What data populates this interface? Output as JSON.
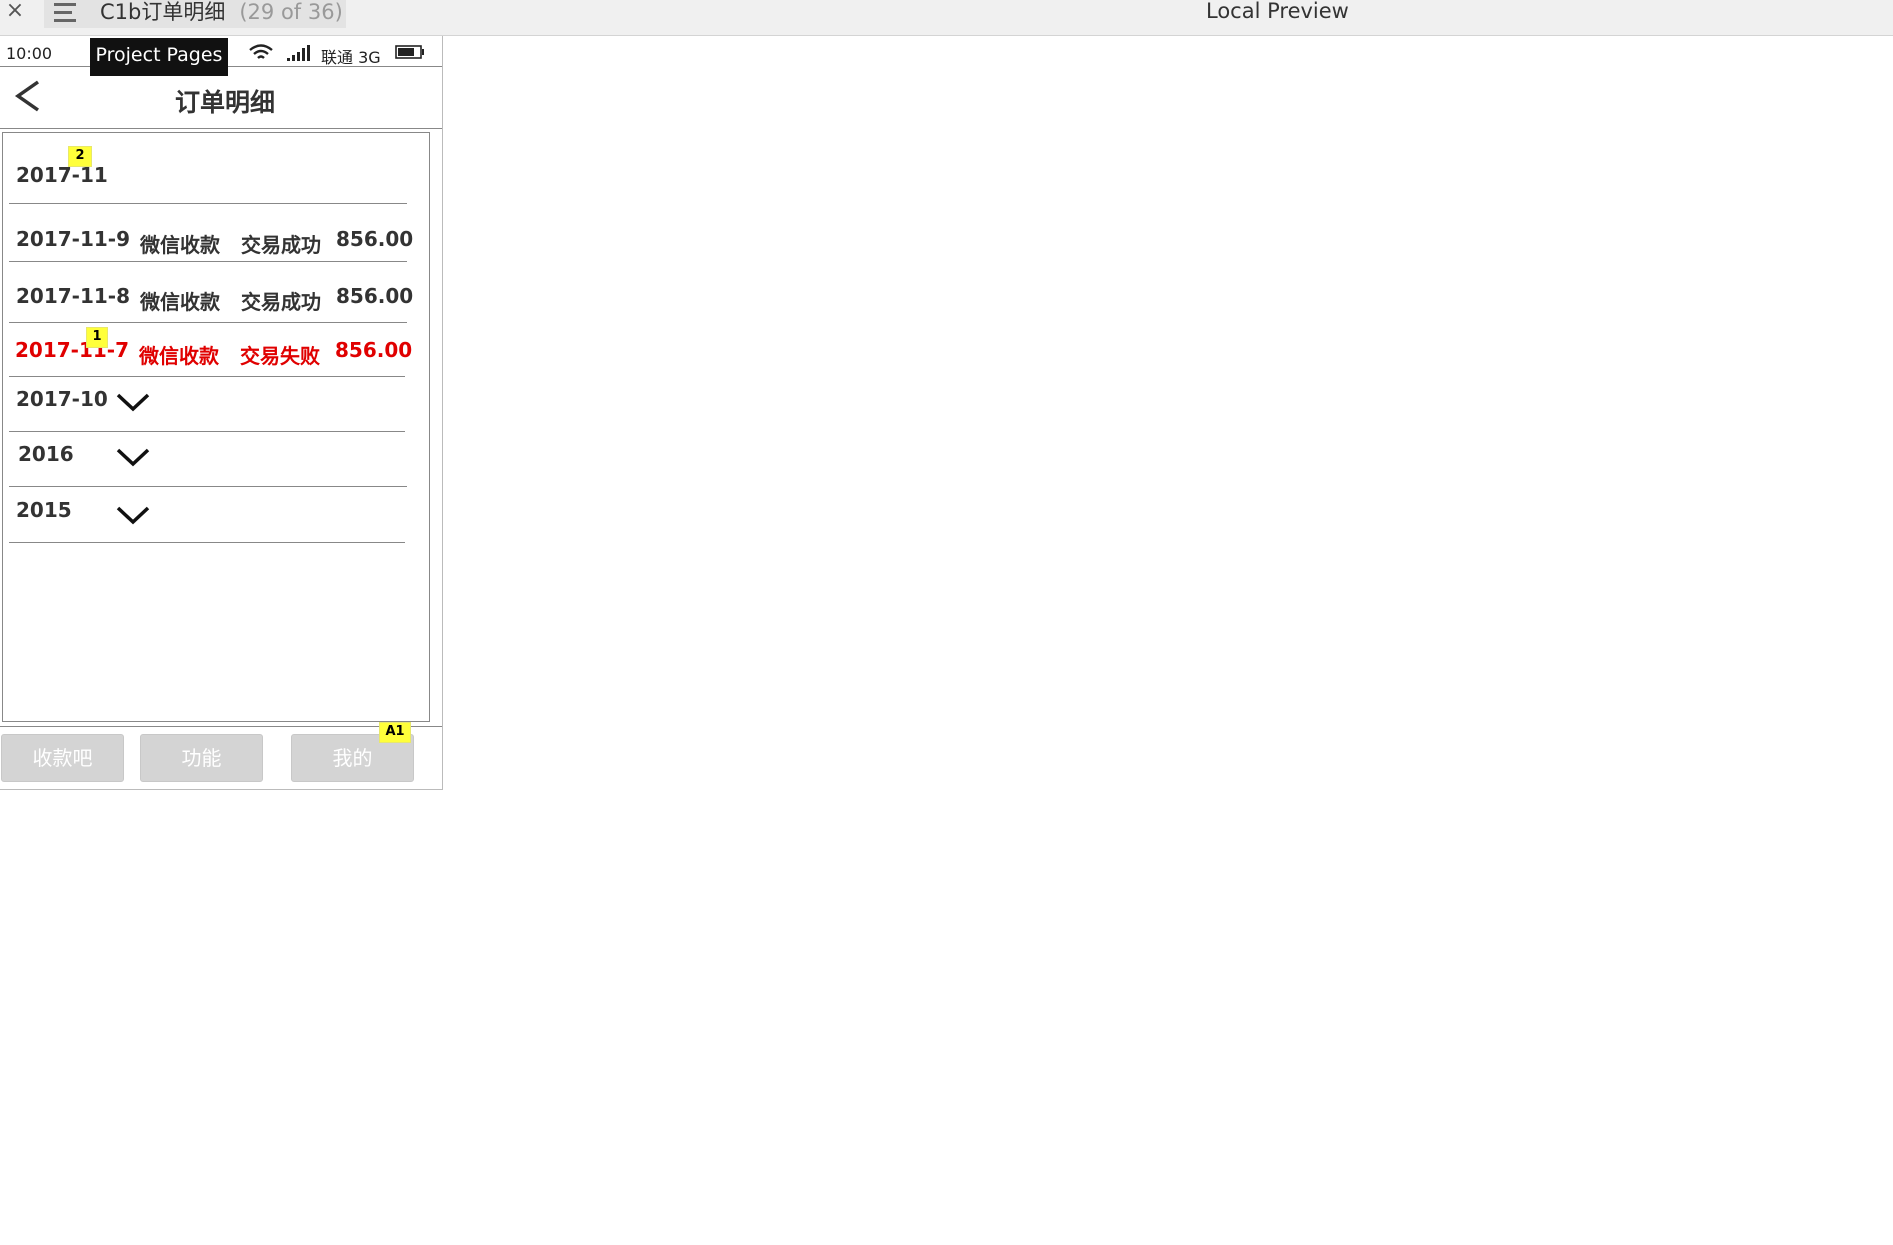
{
  "browser": {
    "close_glyph": "×",
    "tab_title": "C1b订单明细",
    "tab_count": "(29 of 36)",
    "preview_title": "Local Preview"
  },
  "statusbar": {
    "time": "10:00",
    "carrier": "联通 3G",
    "tooltip": "Project Pages"
  },
  "navbar": {
    "title": "订单明细",
    "back_icon": "chevron-left-icon"
  },
  "current_month": {
    "label": "2017-11",
    "badge": "2"
  },
  "transactions": [
    {
      "date": "2017-11-9",
      "channel": "微信收款",
      "status": "交易成功",
      "amount": "856.00",
      "failed": false
    },
    {
      "date": "2017-11-8",
      "channel": "微信收款",
      "status": "交易成功",
      "amount": "856.00",
      "failed": false
    },
    {
      "date": "2017-11-7",
      "channel": "微信收款",
      "status": "交易失败",
      "amount": "856.00",
      "failed": true,
      "badge": "1"
    }
  ],
  "collapsed_groups": [
    {
      "label": "2017-10",
      "icon": "chevron-down-icon"
    },
    {
      "label": "2016",
      "icon": "chevron-down-icon"
    },
    {
      "label": "2015",
      "icon": "chevron-down-icon"
    }
  ],
  "tabbar": {
    "items": [
      "收款吧",
      "功能",
      "我的"
    ],
    "badge": "A1"
  },
  "colors": {
    "failed": "#e00000",
    "badge": "#ffff3a",
    "tab_button": "#d4d4d4"
  }
}
